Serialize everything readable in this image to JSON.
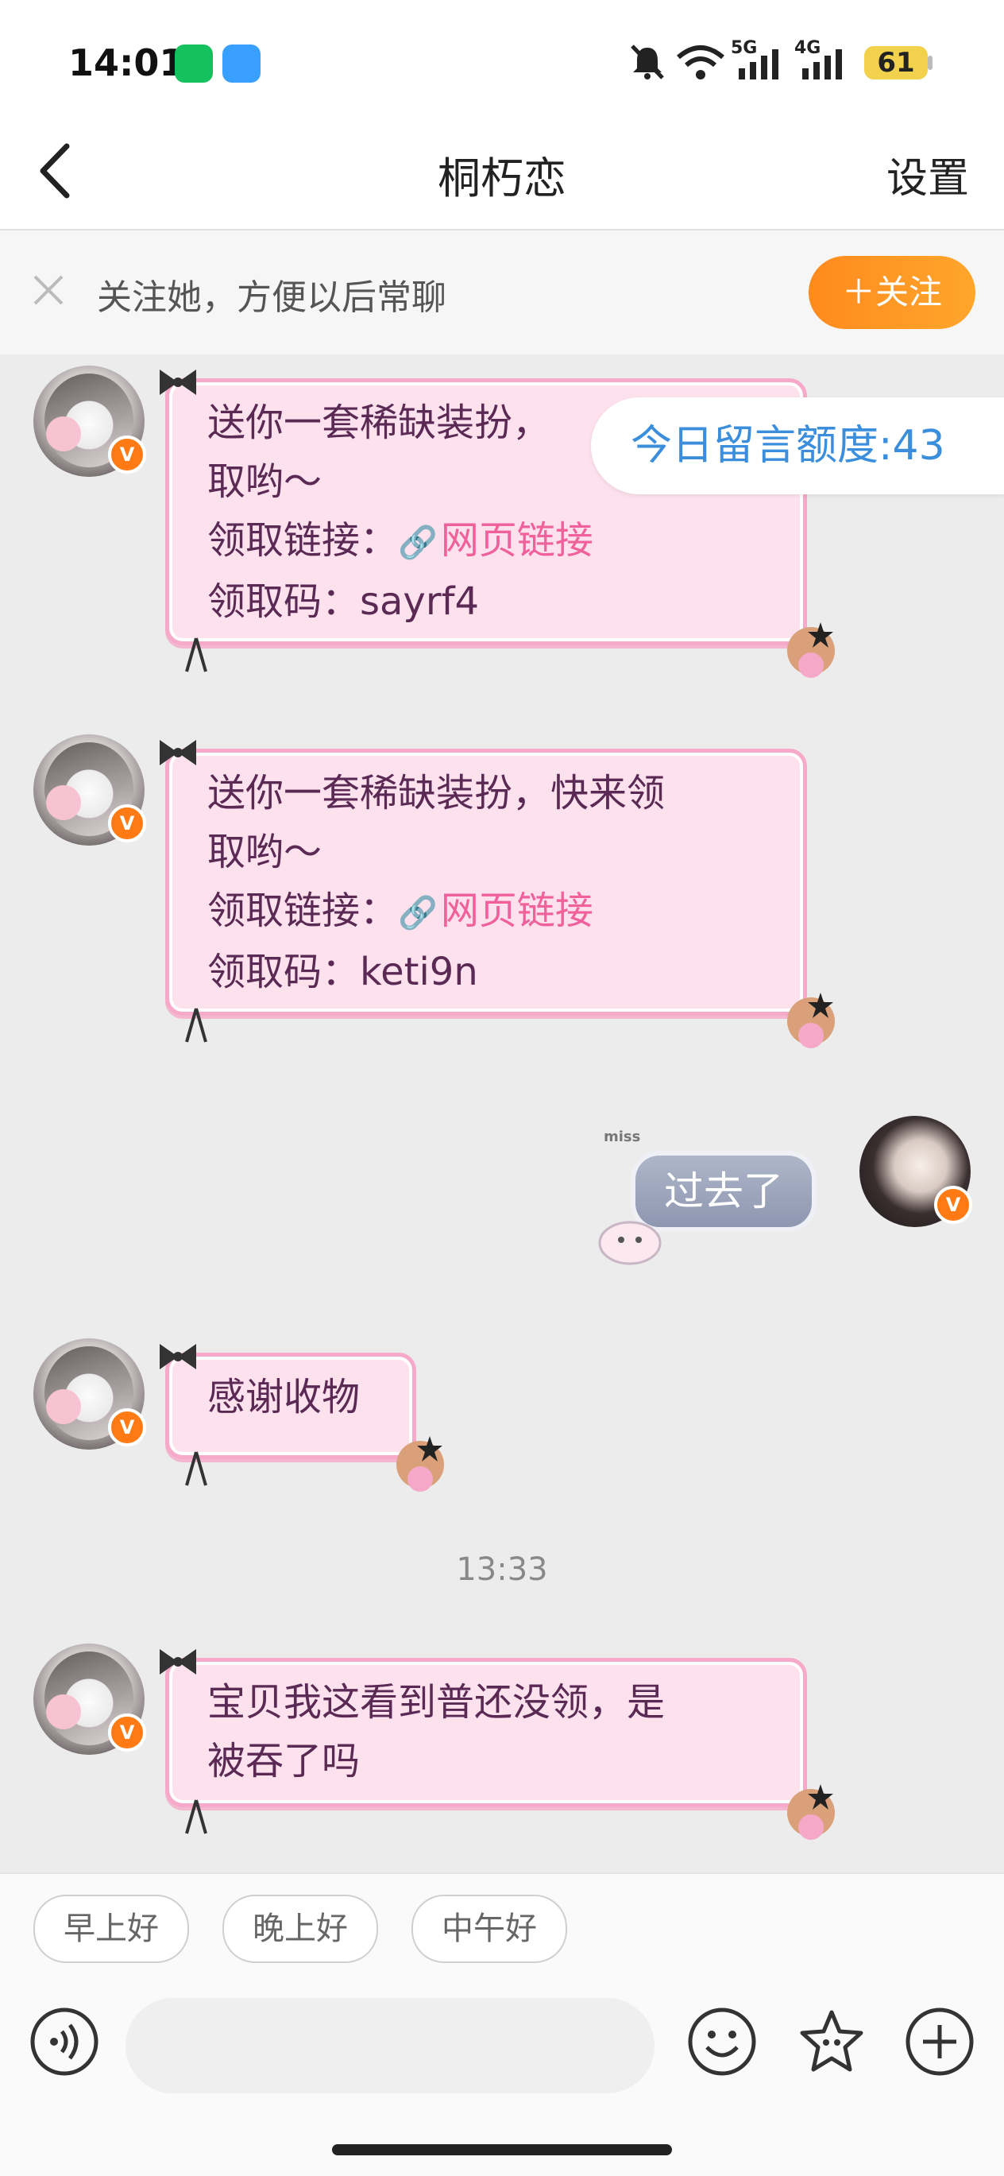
{
  "status_bar": {
    "time": "14:01",
    "battery": "61",
    "net1": "5G",
    "net2": "4G"
  },
  "header": {
    "title": "桐朽恋",
    "settings": "设置"
  },
  "banner": {
    "text": "关注她，方便以后常聊",
    "follow_label": "＋关注"
  },
  "quota": "今日留言额度:43",
  "messages": [
    {
      "side": "left",
      "lines": [
        "送你一套稀缺装扮，",
        "取哟～"
      ],
      "link_prefix": "领取链接：",
      "link_text": "网页链接",
      "code": "领取码：sayrf4"
    },
    {
      "side": "left",
      "lines": [
        "送你一套稀缺装扮，快来领",
        "取哟～"
      ],
      "link_prefix": "领取链接：",
      "link_text": "网页链接",
      "code": "领取码：keti9n"
    },
    {
      "side": "right",
      "text": "过去了",
      "sticker_text": "miss"
    },
    {
      "side": "left",
      "text": "感谢收物"
    },
    {
      "side": "left",
      "lines": [
        "宝贝我这看到普还没领，是",
        "被吞了吗"
      ]
    }
  ],
  "timestamp": "13:33",
  "quick_replies": [
    "早上好",
    "晚上好",
    "中午好"
  ],
  "verified_badge": "V",
  "colors": {
    "accent": "#ff8a1e",
    "bubble_bg": "#fde2ee",
    "bubble_border": "#f6a9c8",
    "link": "#f0609a",
    "quota": "#3a8edb"
  }
}
